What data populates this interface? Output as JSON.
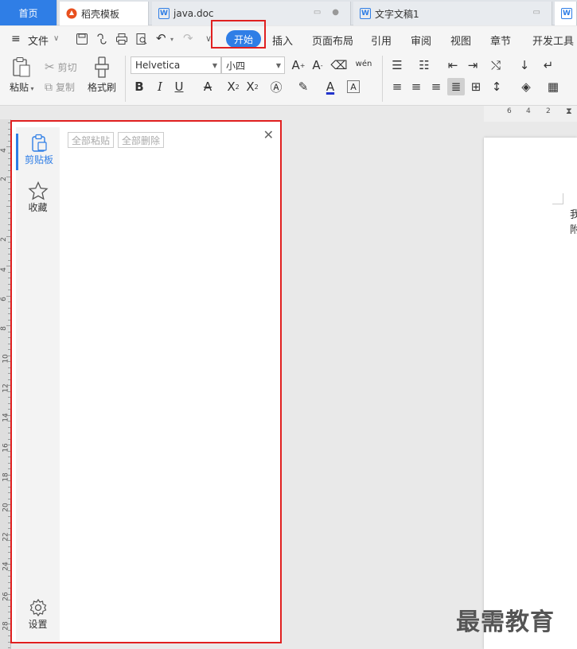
{
  "tabs": [
    {
      "label": "首页"
    },
    {
      "label": "稻壳模板"
    },
    {
      "label": "java.doc"
    },
    {
      "label": "文字文稿1"
    }
  ],
  "menu": {
    "file": "文件",
    "items": [
      "开始",
      "插入",
      "页面布局",
      "引用",
      "审阅",
      "视图",
      "章节",
      "开发工具"
    ]
  },
  "ribbon": {
    "paste": "粘贴",
    "cut": "剪切",
    "copy": "复制",
    "format_painter": "格式刷",
    "font_name": "Helvetica",
    "font_size": "小四",
    "pinyin_glyph": "wén"
  },
  "ruler_top": [
    "6",
    "4",
    "2"
  ],
  "ruler_left": [
    "4",
    "2",
    "2",
    "4",
    "6",
    "8",
    "10",
    "12",
    "14",
    "16",
    "18",
    "20",
    "22",
    "24",
    "26",
    "28"
  ],
  "panel": {
    "tab_clipboard": "剪贴板",
    "tab_favorites": "收藏",
    "settings": "设置",
    "paste_all": "全部粘贴",
    "delete_all": "全部删除"
  },
  "document": {
    "line1": "我",
    "line2": "附"
  },
  "watermark": "最需教育",
  "colors": {
    "accent": "#2f7ee6",
    "highlight_box": "#e02020"
  }
}
